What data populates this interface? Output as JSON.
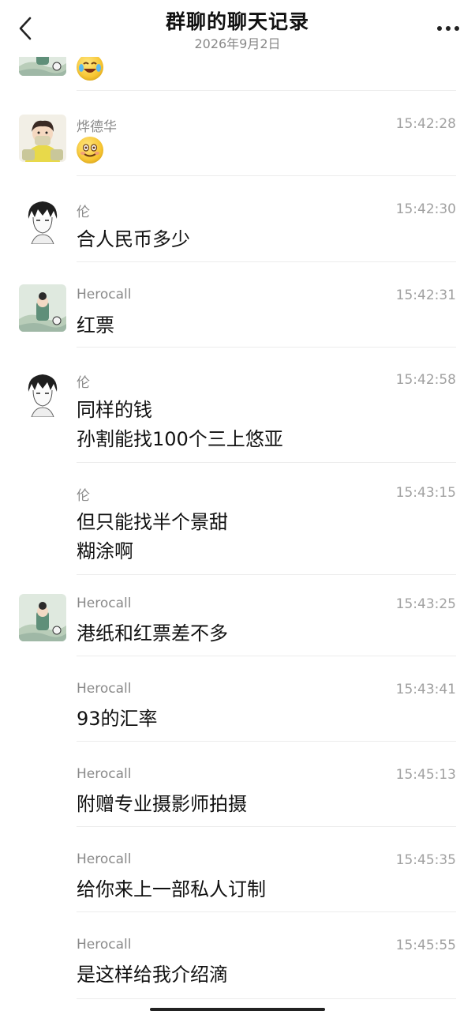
{
  "header": {
    "title": "群聊的聊天记录",
    "subtitle": "2026年9月2日"
  },
  "messages": [
    {
      "sender": "",
      "time": "",
      "lines": [],
      "emoji": "laugh-cry",
      "avatar": "herocall-avatar"
    },
    {
      "sender": "烨德华",
      "time": "15:42:28",
      "lines": [],
      "emoji": "smile",
      "avatar": "yedehua-avatar"
    },
    {
      "sender": "伦",
      "time": "15:42:30",
      "lines": [
        "合人民币多少"
      ],
      "avatar": "lun-avatar"
    },
    {
      "sender": "Herocall",
      "time": "15:42:31",
      "lines": [
        "红票"
      ],
      "avatar": "herocall-avatar"
    },
    {
      "sender": "伦",
      "time": "15:42:58",
      "lines": [
        "同样的钱",
        "孙割能找100个三上悠亚"
      ],
      "avatar": "lun-avatar"
    },
    {
      "sender": "伦",
      "time": "15:43:15",
      "lines": [
        "但只能找半个景甜",
        "糊涂啊"
      ],
      "avatar": ""
    },
    {
      "sender": "Herocall",
      "time": "15:43:25",
      "lines": [
        "港纸和红票差不多"
      ],
      "avatar": "herocall-avatar"
    },
    {
      "sender": "Herocall",
      "time": "15:43:41",
      "lines": [
        "93的汇率"
      ],
      "avatar": ""
    },
    {
      "sender": "Herocall",
      "time": "15:45:13",
      "lines": [
        "附赠专业摄影师拍摄"
      ],
      "avatar": ""
    },
    {
      "sender": "Herocall",
      "time": "15:45:35",
      "lines": [
        "给你来上一部私人订制"
      ],
      "avatar": ""
    },
    {
      "sender": "Herocall",
      "time": "15:45:55",
      "lines": [
        "是这样给我介绍滴"
      ],
      "avatar": ""
    }
  ]
}
